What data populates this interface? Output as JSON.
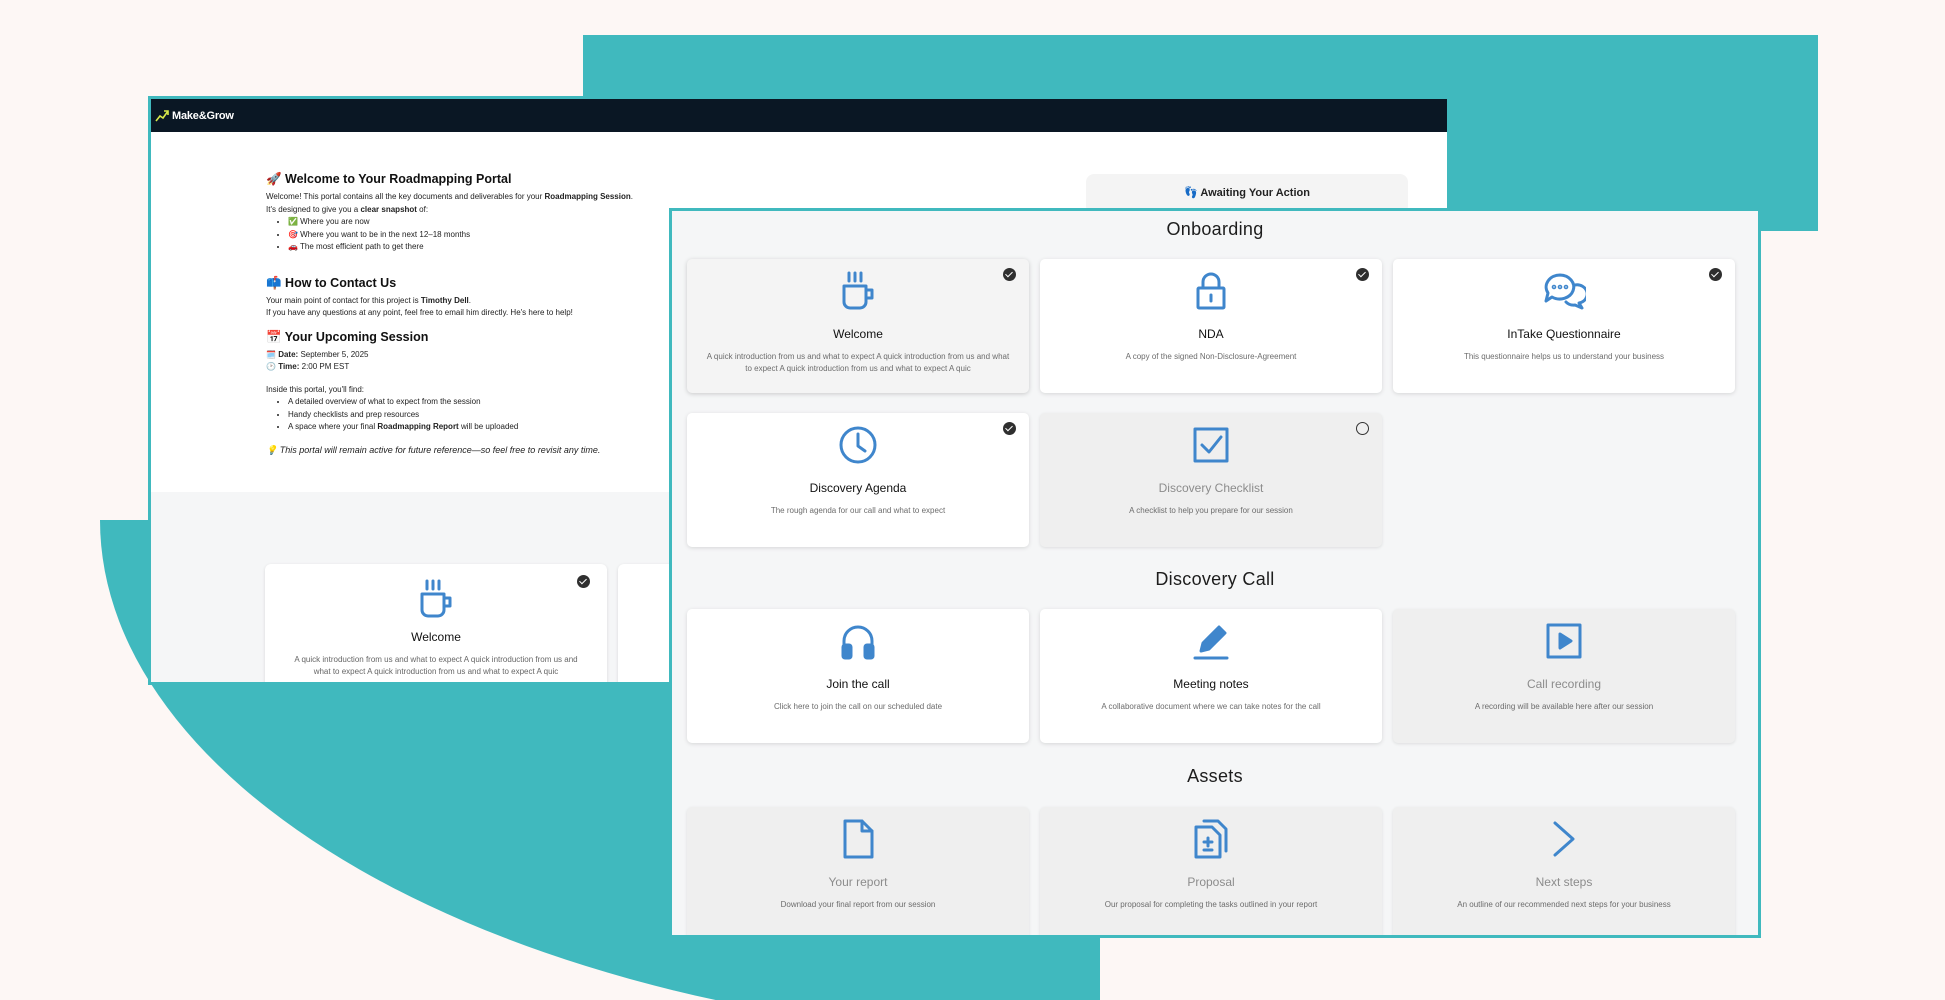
{
  "app": {
    "logo_text": "Make&Grow"
  },
  "intro": {
    "welcome_heading": "🚀 Welcome to Your Roadmapping Portal",
    "welcome_line1_pre": "Welcome! This portal contains all the key documents and deliverables for your ",
    "welcome_line1_bold": "Roadmapping Session",
    "welcome_line1_post": ".",
    "welcome_line2_pre": "It's designed to give you a ",
    "welcome_line2_bold": "clear snapshot",
    "welcome_line2_post": " of:",
    "snapshot_items": [
      "✅ Where you are now",
      "🎯 Where you want to be in the next 12–18 months",
      "🚗 The most efficient path to get there"
    ],
    "contact_heading": "📫 How to Contact Us",
    "contact_line1_pre": "Your main point of contact for this project is ",
    "contact_name": "Timothy Dell",
    "contact_line1_post": ".",
    "contact_line2": "If you have any questions at any point, feel free to email him directly. He's here to help!",
    "session_heading": "📅 Your Upcoming Session",
    "date_label": "Date:",
    "date_value": " September 5, 2025",
    "date_icon": "🗓️",
    "time_label": "Time:",
    "time_value": " 2:00 PM EST",
    "time_icon": "🕑",
    "inside_heading": "Inside this portal, you'll find:",
    "inside_item1": "A detailed overview of what to expect from the session",
    "inside_item2": "Handy checklists and prep resources",
    "inside_item3_pre": "A space where your final ",
    "inside_item3_bold": "Roadmapping Report",
    "inside_item3_post": " will be uploaded",
    "footer_note": "💡 This portal will remain active for future reference—so feel free to revisit any time."
  },
  "awaiting": {
    "label": "👣 Awaiting Your Action"
  },
  "back_card": {
    "title": "Welcome",
    "desc": "A quick introduction from us and what to expect A quick introduction from us and what to expect A quick introduction from us and what to expect A quic",
    "icon": "coffee-cup-icon",
    "status": "done"
  },
  "sections": [
    {
      "title": "Onboarding",
      "cards": [
        {
          "title": "Welcome",
          "desc": "A quick introduction from us and what to expect A quick introduction from us and what to expect A quick introduction from us and what to expect A quic",
          "icon": "coffee-cup-icon",
          "status": "done",
          "state": "selected"
        },
        {
          "title": "NDA",
          "desc": "A copy of the signed Non-Disclosure-Agreement",
          "icon": "lock-icon",
          "status": "done",
          "state": "active"
        },
        {
          "title": "InTake Questionnaire",
          "desc": "This questionnaire helps us to understand your business",
          "icon": "chat-bubbles-icon",
          "status": "done",
          "state": "active"
        },
        {
          "title": "Discovery Agenda",
          "desc": "The rough agenda for our call and what to expect",
          "icon": "clock-icon",
          "status": "done",
          "state": "active"
        },
        {
          "title": "Discovery Checklist",
          "desc": "A checklist to help you prepare for our session",
          "icon": "checkbox-icon",
          "status": "todo",
          "state": "inactive"
        }
      ]
    },
    {
      "title": "Discovery Call",
      "cards": [
        {
          "title": "Join the call",
          "desc": "Click here to join the call on our scheduled date",
          "icon": "headphones-icon",
          "state": "active"
        },
        {
          "title": "Meeting notes",
          "desc": "A collaborative document where we can take notes for the call",
          "icon": "pen-icon",
          "state": "active"
        },
        {
          "title": "Call recording",
          "desc": "A recording will be available here after our session",
          "icon": "play-video-icon",
          "state": "inactive"
        }
      ]
    },
    {
      "title": "Assets",
      "cards": [
        {
          "title": "Your report",
          "desc": "Download your final report from our session",
          "icon": "document-icon",
          "state": "inactive"
        },
        {
          "title": "Proposal",
          "desc": "Our proposal for completing the tasks outlined in your report",
          "icon": "documents-icon",
          "state": "inactive"
        },
        {
          "title": "Next steps",
          "desc": "An outline of our recommended next steps for your business",
          "icon": "chevron-right-icon",
          "state": "inactive"
        }
      ]
    }
  ],
  "colors": {
    "teal": "#40b9be",
    "icon_blue": "#3f86cc",
    "topbar": "#0a1724"
  }
}
